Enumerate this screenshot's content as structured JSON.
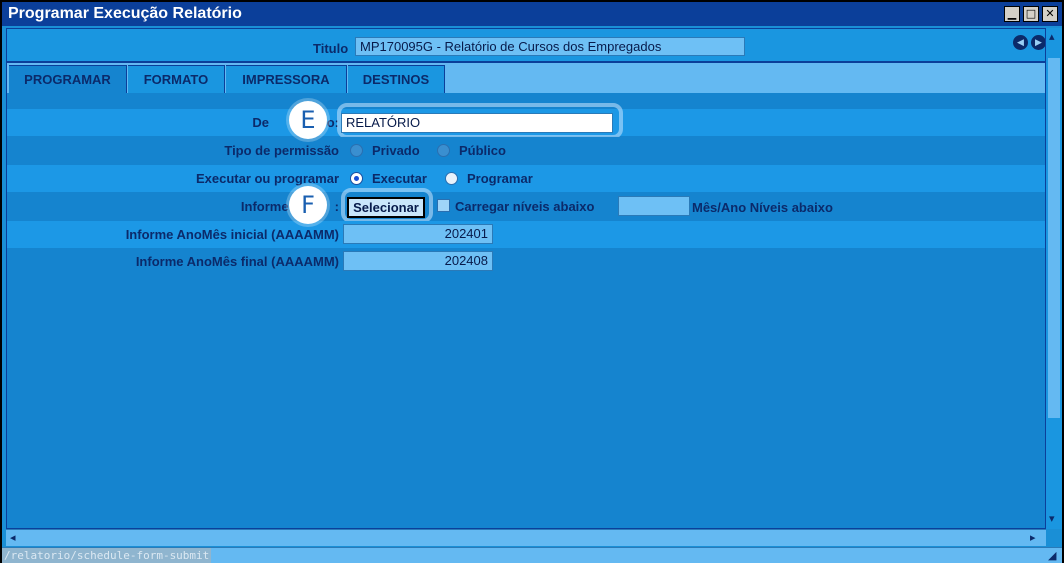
{
  "window": {
    "title": "Programar Execução Relatório",
    "controls": [
      "▁",
      "□",
      "✕"
    ]
  },
  "header": {
    "label": "Titulo",
    "value": "MP170095G - Relatório de Cursos dos Empregados"
  },
  "tabs": [
    {
      "label": "PROGRAMAR",
      "active": true
    },
    {
      "label": "FORMATO",
      "active": false
    },
    {
      "label": "IMPRESSORA",
      "active": false
    },
    {
      "label": "DESTINOS",
      "active": false
    }
  ],
  "form": {
    "descricao": {
      "label_visible_start": "De",
      "label_visible_end": "o:",
      "value": "RELATÓRIO"
    },
    "tipo_permissao": {
      "label": "Tipo de permissão",
      "options": [
        "Privado",
        "Público"
      ],
      "selected": ""
    },
    "executar": {
      "label": "Executar ou programar",
      "options": [
        "Executar",
        "Programar"
      ],
      "selected": "Executar"
    },
    "niveis": {
      "label_visible_start": "Informe a L",
      "label_visible_end": ":",
      "button": "Selecionar",
      "checkbox_label": "Carregar níveis abaixo",
      "checkbox_checked": false,
      "extra_value": "",
      "extra_label": "Mês/Ano Níveis abaixo"
    },
    "inicial": {
      "label": "Informe AnoMês inicial (AAAAMM)",
      "value": "202401"
    },
    "final": {
      "label": "Informe AnoMês final (AAAAMM)",
      "value": "202408"
    }
  },
  "markers": {
    "e": "E",
    "f": "F"
  },
  "status": {
    "text": "/relatorio/schedule-form-submit"
  },
  "colors": {
    "titlebar": "#0b3f9a",
    "panel": "#1584cf",
    "accent": "#64b9f2"
  }
}
